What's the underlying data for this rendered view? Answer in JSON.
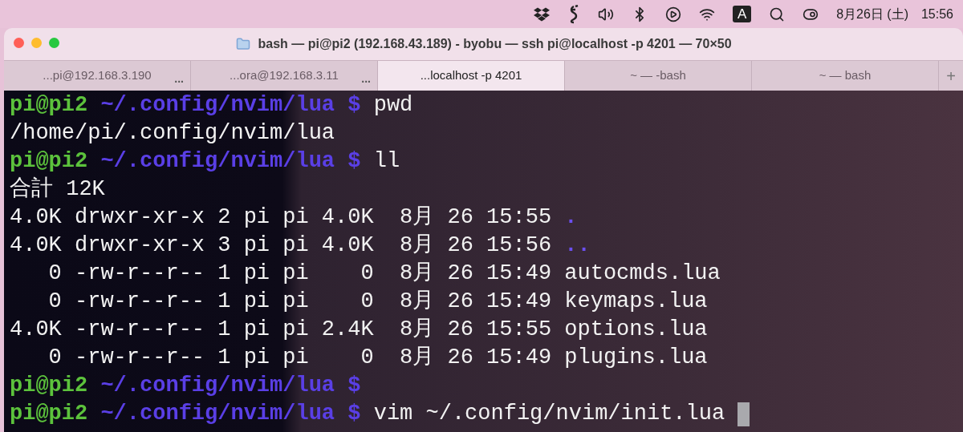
{
  "menu_bar": {
    "input_indicator": "A",
    "date": "8月26日 (土)",
    "time": "15:56"
  },
  "window": {
    "title": "bash — pi@pi2 (192.168.43.189) - byobu — ssh pi@localhost -p 4201 — 70×50"
  },
  "tabs": [
    {
      "label": "...pi@192.168.3.190",
      "badge": "...",
      "selected": false
    },
    {
      "label": "...ora@192.168.3.11",
      "badge": "...",
      "selected": false
    },
    {
      "label": "...localhost -p 4201",
      "selected": true
    },
    {
      "label": "~ — -bash",
      "selected": false
    },
    {
      "label": "~ — bash",
      "selected": false
    }
  ],
  "new_tab_button": "+",
  "terminal": {
    "lines": [
      [
        {
          "kind": "user",
          "text": "pi@pi2"
        },
        {
          "kind": "path",
          "text": " ~/.config/nvim/lua $"
        },
        {
          "kind": "text",
          "text": " pwd"
        }
      ],
      [
        {
          "kind": "text",
          "text": "/home/pi/.config/nvim/lua"
        }
      ],
      [
        {
          "kind": "user",
          "text": "pi@pi2"
        },
        {
          "kind": "path",
          "text": " ~/.config/nvim/lua $"
        },
        {
          "kind": "text",
          "text": " ll"
        }
      ],
      [
        {
          "kind": "text",
          "text": "合計 12K"
        }
      ],
      [
        {
          "kind": "text",
          "text": "4.0K drwxr-xr-x 2 pi pi 4.0K  8月 26 15:55 "
        },
        {
          "kind": "dir",
          "text": "."
        }
      ],
      [
        {
          "kind": "text",
          "text": "4.0K drwxr-xr-x 3 pi pi 4.0K  8月 26 15:56 "
        },
        {
          "kind": "dir",
          "text": ".."
        }
      ],
      [
        {
          "kind": "text",
          "text": "   0 -rw-r--r-- 1 pi pi    0  8月 26 15:49 autocmds.lua"
        }
      ],
      [
        {
          "kind": "text",
          "text": "   0 -rw-r--r-- 1 pi pi    0  8月 26 15:49 keymaps.lua"
        }
      ],
      [
        {
          "kind": "text",
          "text": "4.0K -rw-r--r-- 1 pi pi 2.4K  8月 26 15:55 options.lua"
        }
      ],
      [
        {
          "kind": "text",
          "text": "   0 -rw-r--r-- 1 pi pi    0  8月 26 15:49 plugins.lua"
        }
      ],
      [
        {
          "kind": "user",
          "text": "pi@pi2"
        },
        {
          "kind": "path",
          "text": " ~/.config/nvim/lua $"
        }
      ],
      [
        {
          "kind": "user",
          "text": "pi@pi2"
        },
        {
          "kind": "path",
          "text": " ~/.config/nvim/lua $"
        },
        {
          "kind": "text",
          "text": " vim ~/.config/nvim/init.lua"
        },
        {
          "kind": "cursor"
        }
      ]
    ]
  }
}
